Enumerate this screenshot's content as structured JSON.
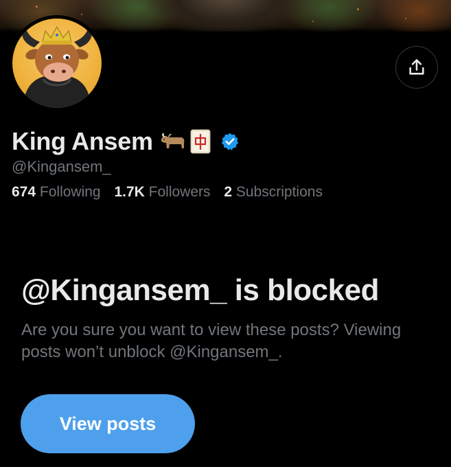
{
  "profile": {
    "display_name": "King Ansem",
    "handle": "@Kingansem_",
    "name_emojis": [
      "ox-emoji",
      "mahjong-red-dragon-emoji"
    ],
    "verified": true,
    "verified_badge_color": "#1d9bf0"
  },
  "stats": [
    {
      "value": "674",
      "label": "Following"
    },
    {
      "value": "1.7K",
      "label": "Followers"
    },
    {
      "value": "2",
      "label": "Subscriptions"
    }
  ],
  "blocked": {
    "title": "@Kingansem_ is blocked",
    "description": "Are you sure you want to view these posts? Viewing posts won’t unblock @Kingansem_.",
    "button_label": "View posts"
  },
  "actions": {
    "share_icon": "share-icon"
  },
  "colors": {
    "background": "#000000",
    "primary_text": "#e7e9ea",
    "secondary_text": "#71767b",
    "button": "#4fa0ec"
  }
}
